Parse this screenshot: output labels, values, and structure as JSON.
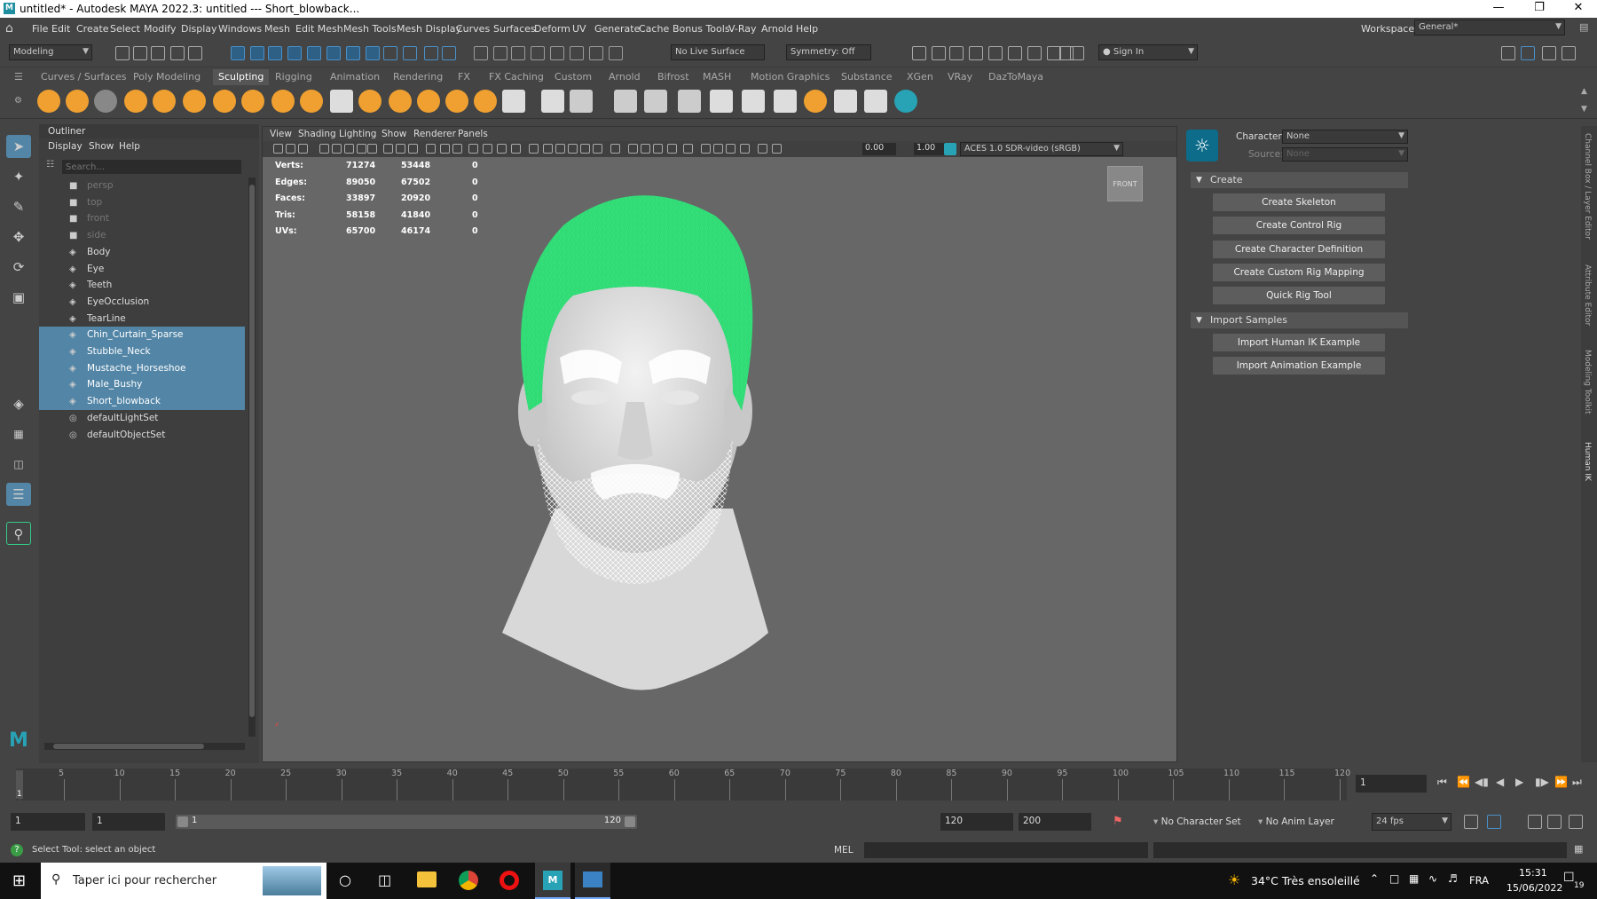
{
  "window": {
    "title": "untitled* - Autodesk MAYA 2022.3: untitled  ---  Short_blowback..."
  },
  "menus": [
    "File",
    "Edit",
    "Create",
    "Select",
    "Modify",
    "Display",
    "Windows",
    "Mesh",
    "Edit Mesh",
    "Mesh Tools",
    "Mesh Display",
    "Curves",
    "Surfaces",
    "Deform",
    "UV",
    "Generate",
    "Cache",
    "Bonus Tools",
    "V-Ray",
    "Arnold",
    "Help"
  ],
  "workspace": {
    "label": "Workspace:",
    "value": "General*"
  },
  "statusline": {
    "mode": "Modeling",
    "live_surface": "No Live Surface",
    "symmetry": "Symmetry: Off",
    "sign_in": "Sign In"
  },
  "shelf_tabs": [
    "Curves / Surfaces",
    "Poly Modeling",
    "Sculpting",
    "Rigging",
    "Animation",
    "Rendering",
    "FX",
    "FX Caching",
    "Custom",
    "Arnold",
    "Bifrost",
    "MASH",
    "Motion Graphics",
    "Substance",
    "XGen",
    "VRay",
    "DazToMaya"
  ],
  "shelf_active_tab": "Sculpting",
  "outliner": {
    "title": "Outliner",
    "menus": [
      "Display",
      "Show",
      "Help"
    ],
    "search_placeholder": "Search...",
    "items": [
      {
        "label": "persp",
        "type": "camera"
      },
      {
        "label": "top",
        "type": "camera"
      },
      {
        "label": "front",
        "type": "camera"
      },
      {
        "label": "side",
        "type": "camera"
      },
      {
        "label": "Body",
        "type": "mesh"
      },
      {
        "label": "Eye",
        "type": "mesh"
      },
      {
        "label": "Teeth",
        "type": "mesh"
      },
      {
        "label": "EyeOcclusion",
        "type": "mesh"
      },
      {
        "label": "TearLine",
        "type": "mesh"
      },
      {
        "label": "Chin_Curtain_Sparse",
        "type": "mesh"
      },
      {
        "label": "Stubble_Neck",
        "type": "mesh"
      },
      {
        "label": "Mustache_Horseshoe",
        "type": "mesh"
      },
      {
        "label": "Male_Bushy",
        "type": "mesh"
      },
      {
        "label": "Short_blowback",
        "type": "mesh"
      },
      {
        "label": "defaultLightSet",
        "type": "set"
      },
      {
        "label": "defaultObjectSet",
        "type": "set"
      }
    ]
  },
  "viewport": {
    "menus": [
      "View",
      "Shading",
      "Lighting",
      "Show",
      "Renderer",
      "Panels"
    ],
    "field_a": "0.00",
    "field_b": "1.00",
    "colorspace": "ACES 1.0 SDR-video (sRGB)",
    "view_cube": "FRONT",
    "hud": [
      {
        "label": "Verts:",
        "a": "71274",
        "b": "53448",
        "c": "0"
      },
      {
        "label": "Edges:",
        "a": "89050",
        "b": "67502",
        "c": "0"
      },
      {
        "label": "Faces:",
        "a": "33897",
        "b": "20920",
        "c": "0"
      },
      {
        "label": "Tris:",
        "a": "58158",
        "b": "41840",
        "c": "0"
      },
      {
        "label": "UVs:",
        "a": "65700",
        "b": "46174",
        "c": "0"
      }
    ]
  },
  "humanik": {
    "character_label": "Character:",
    "character_value": "None",
    "source_label": "Source:",
    "source_value": "None",
    "create_section": "Create",
    "create_buttons": [
      "Create Skeleton",
      "Create Control Rig",
      "Create Character Definition",
      "Create Custom Rig Mapping",
      "Quick Rig Tool"
    ],
    "import_section": "Import Samples",
    "import_buttons": [
      "Import Human IK Example",
      "Import Animation Example"
    ]
  },
  "right_tabs": [
    "Channel Box / Layer Editor",
    "Attribute Editor",
    "Modeling Toolkit",
    "Human IK"
  ],
  "timeline": {
    "ticks": [
      "5",
      "10",
      "15",
      "20",
      "25",
      "30",
      "35",
      "40",
      "45",
      "50",
      "55",
      "60",
      "65",
      "70",
      "75",
      "80",
      "85",
      "90",
      "95",
      "100",
      "105",
      "110",
      "115",
      "120"
    ],
    "current_frame": "1",
    "current_field": "1"
  },
  "range": {
    "start": "1",
    "start2": "1",
    "slider_start": "1",
    "slider_end": "120",
    "end": "120",
    "end2": "200",
    "character_set": "No Character Set",
    "anim_layer": "No Anim Layer",
    "fps": "24 fps"
  },
  "command": {
    "help": "Select Tool: select an object",
    "lang": "MEL"
  },
  "taskbar": {
    "search_placeholder": "Taper ici pour rechercher",
    "weather": "34°C  Très ensoleillé",
    "lang": "FRA",
    "time": "15:31",
    "date": "15/06/2022",
    "notif": "19"
  },
  "colors": {
    "accent_select": "#5285a6",
    "hair_green": "#34e07a",
    "maya_teal": "#27a3b5"
  }
}
